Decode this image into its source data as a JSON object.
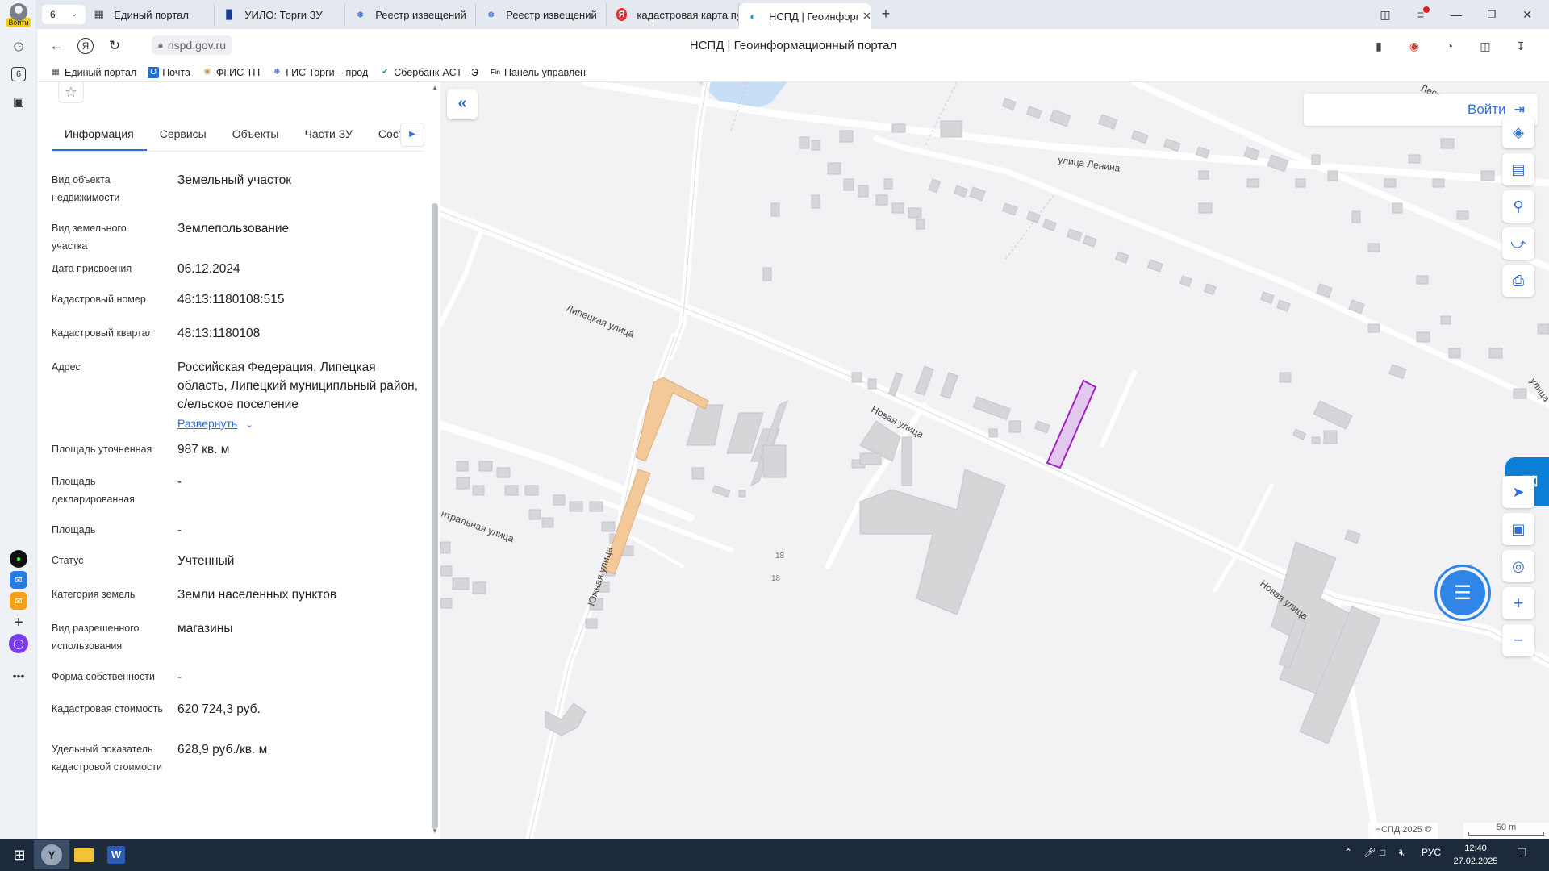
{
  "browser": {
    "sidebar_login_badge": "Войти",
    "tab_count": "6",
    "tabs": [
      {
        "label": "Единый портал",
        "icon": "building-icon"
      },
      {
        "label": "УИЛО: Торги ЗУ",
        "icon": "chart-icon"
      },
      {
        "label": "Реестр извещений",
        "icon": "emblem-icon"
      },
      {
        "label": "Реестр извещений",
        "icon": "emblem-icon"
      },
      {
        "label": "кадастровая карта публи",
        "icon": "yandex-icon"
      },
      {
        "label": "НСПД | Геоинформаци",
        "icon": "nspd-icon"
      }
    ],
    "url": "nspd.gov.ru",
    "page_title": "НСПД | Геоинформационный портал",
    "bookmarks": [
      {
        "label": "Единый портал"
      },
      {
        "label": "Почта"
      },
      {
        "label": "ФГИС ТП"
      },
      {
        "label": "ГИС Торги – прод"
      },
      {
        "label": "Сбербанк-АСТ - Э"
      },
      {
        "label": "Панель управлен"
      }
    ]
  },
  "panel": {
    "tabs": [
      "Информация",
      "Сервисы",
      "Объекты",
      "Части ЗУ",
      "Состав"
    ],
    "active_tab": "Информация",
    "expand_label": "Развернуть",
    "fields": [
      {
        "label": "Вид объекта недвижимости",
        "value": "Земельный участок"
      },
      {
        "label": "Вид земельного участка",
        "value": "Землепользование"
      },
      {
        "label": "Дата присвоения",
        "value": "06.12.2024"
      },
      {
        "label": "Кадастровый номер",
        "value": "48:13:1180108:515"
      },
      {
        "label": "Кадастровый квартал",
        "value": "48:13:1180108"
      },
      {
        "label": "Адрес",
        "value": "Российская Федерация, Липецкая область, Липецкий муниципльный район, с/ельское поселение"
      },
      {
        "label": "Площадь уточненная",
        "value": "987 кв. м"
      },
      {
        "label": "Площадь декларированная",
        "value": "-"
      },
      {
        "label": "Площадь",
        "value": "-"
      },
      {
        "label": "Статус",
        "value": "Учтенный"
      },
      {
        "label": "Категория земель",
        "value": "Земли населенных пунктов"
      },
      {
        "label": "Вид разрешенного использования",
        "value": "магазины"
      },
      {
        "label": "Форма собственности",
        "value": "-"
      },
      {
        "label": "Кадастровая стоимость",
        "value": "620 724,3 руб."
      },
      {
        "label": "Удельный показатель кадастровой стоимости",
        "value": "628,9 руб./кв. м"
      }
    ]
  },
  "map": {
    "login_label": "Войти",
    "streets": [
      "Лесная улица",
      "улица Ленина",
      "Липецкая улица",
      "Новая улица",
      "Новая улица",
      "нтральная улица",
      "Южная улица",
      "улица"
    ],
    "house_numbers": [
      "18",
      "18"
    ],
    "copyright": "НСПД 2025 ©",
    "scale_label": "50 m",
    "colors": {
      "parcel": "#a020c0",
      "parcel_fill": "#e3c8ee",
      "building_orange": "#f3c99a",
      "water": "#c8def7",
      "road": "#ffffff",
      "building": "#d6d6d9",
      "accent": "#2f6fd8"
    }
  },
  "taskbar": {
    "language": "РУС",
    "time": "12:40",
    "date": "27.02.2025"
  }
}
